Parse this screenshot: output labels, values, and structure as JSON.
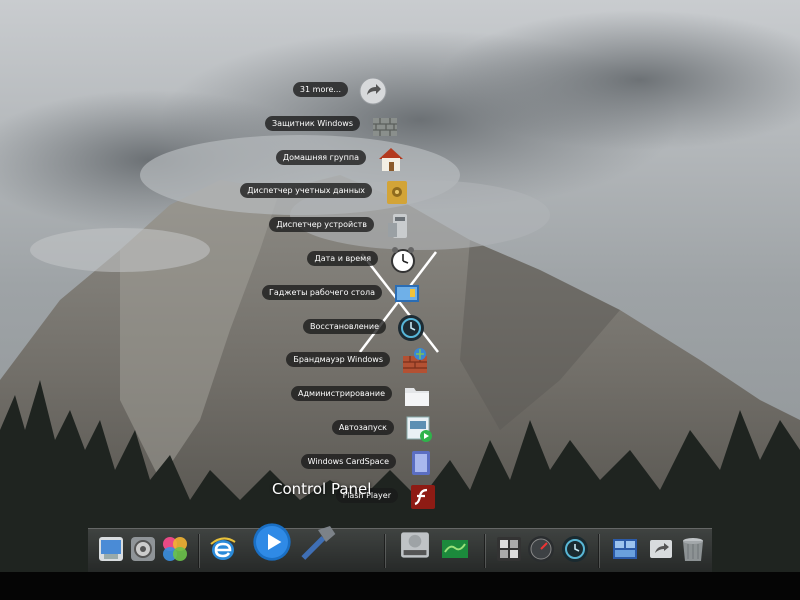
{
  "stack": {
    "title": "Control Panel",
    "items": [
      {
        "label": "31 more...",
        "icon": "arrow-icon"
      },
      {
        "label": "Защитник Windows",
        "icon": "wall-icon"
      },
      {
        "label": "Домашняя группа",
        "icon": "house-icon"
      },
      {
        "label": "Диспетчер учетных данных",
        "icon": "safe-icon"
      },
      {
        "label": "Диспетчер устройств",
        "icon": "device-icon"
      },
      {
        "label": "Дата и время",
        "icon": "clock-icon"
      },
      {
        "label": "Гаджеты рабочего стола",
        "icon": "gadgets-icon"
      },
      {
        "label": "Восстановление",
        "icon": "restore-icon"
      },
      {
        "label": "Брандмауэр Windows",
        "icon": "firewall-icon"
      },
      {
        "label": "Администрирование",
        "icon": "folder-icon"
      },
      {
        "label": "Автозапуск",
        "icon": "autoplay-icon"
      },
      {
        "label": "Windows CardSpace",
        "icon": "cardspace-icon"
      },
      {
        "label": "Flash Player",
        "icon": "flash-icon"
      }
    ]
  },
  "dock": {
    "icons": [
      "finder-icon",
      "system-prefs-icon",
      "game-center-icon",
      "internet-explorer-icon",
      "media-player-icon",
      "tools-hammer-icon",
      "hard-drive-icon",
      "nvidia-icon",
      "widgets-icon",
      "dashboard-gauge-icon",
      "time-machine-icon",
      "window-tiles-icon",
      "share-icon",
      "trash-icon"
    ]
  }
}
